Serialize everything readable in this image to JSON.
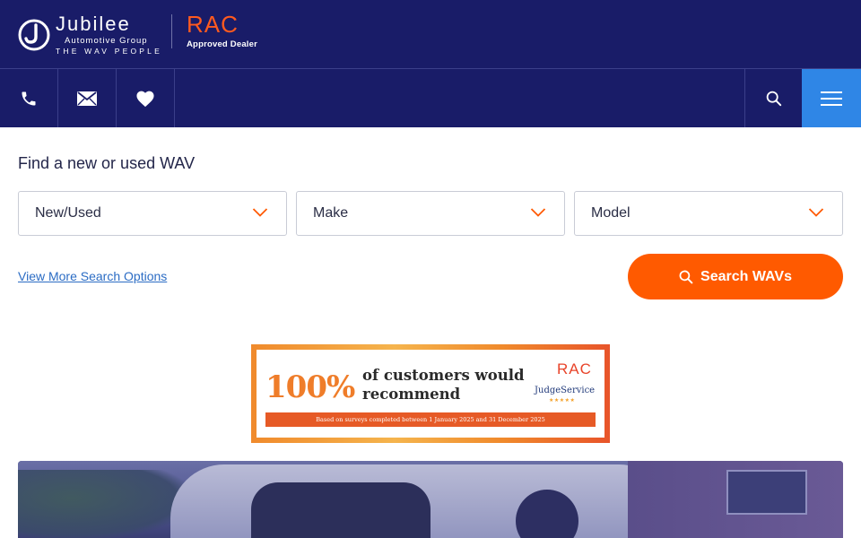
{
  "header": {
    "logo": {
      "name": "Jubilee",
      "subtitle": "Automotive Group",
      "tagline": "THE WAV PEOPLE"
    },
    "partner": {
      "name": "RAC",
      "label": "Approved Dealer"
    }
  },
  "nav": {
    "icons": [
      "phone-icon",
      "mail-icon",
      "heart-icon",
      "search-icon",
      "menu-icon"
    ]
  },
  "search": {
    "title": "Find a new or used WAV",
    "selects": [
      {
        "label": "New/Used"
      },
      {
        "label": "Make"
      },
      {
        "label": "Model"
      }
    ],
    "more_options": "View More Search Options",
    "button_label": "Search WAVs"
  },
  "banner": {
    "percent": "100%",
    "line1": "of customers would",
    "line2": "recommend",
    "rac": "RAC",
    "judge": "JudgeService",
    "stars": "★★★★★",
    "footnote": "Based on surveys completed between 1 January 2025 and 31 December 2025"
  },
  "colors": {
    "navy": "#191c68",
    "accent_orange": "#ff5a00",
    "menu_blue": "#2f86e6",
    "link_blue": "#2b6cc4"
  }
}
